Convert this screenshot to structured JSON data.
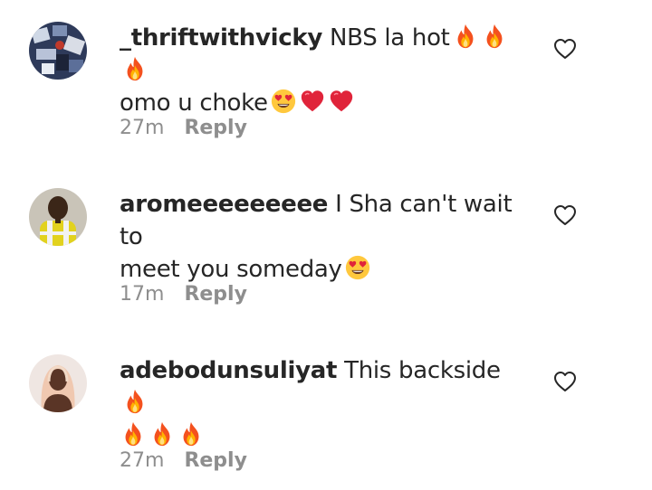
{
  "comments": [
    {
      "username": "_thriftwithvicky",
      "text_line1": "NBS la hot",
      "text_line2": "omo u choke",
      "time": "27m",
      "reply_label": "Reply",
      "emojis": [
        "fire-emoji",
        "fire-emoji",
        "fire-emoji",
        "heart-eyes-emoji",
        "red-heart-emoji",
        "red-heart-emoji"
      ]
    },
    {
      "username": "aromeeeeeeeee",
      "text_line1": "I Sha can't wait to",
      "text_line2": "meet you someday",
      "time": "17m",
      "reply_label": "Reply",
      "emojis": [
        "heart-eyes-emoji"
      ]
    },
    {
      "username": "adebodunsuliyat",
      "text_line1": "This backside",
      "text_line2": "",
      "time": "27m",
      "reply_label": "Reply",
      "emojis": [
        "fire-emoji",
        "fire-emoji",
        "fire-emoji",
        "fire-emoji"
      ]
    }
  ],
  "icons": {
    "like": "heart-outline-icon"
  },
  "colors": {
    "text": "#262626",
    "secondary": "#8e8e8e",
    "fire": "#f57c1f",
    "heart": "#e0243a",
    "emoji_face": "#ffc83d"
  }
}
